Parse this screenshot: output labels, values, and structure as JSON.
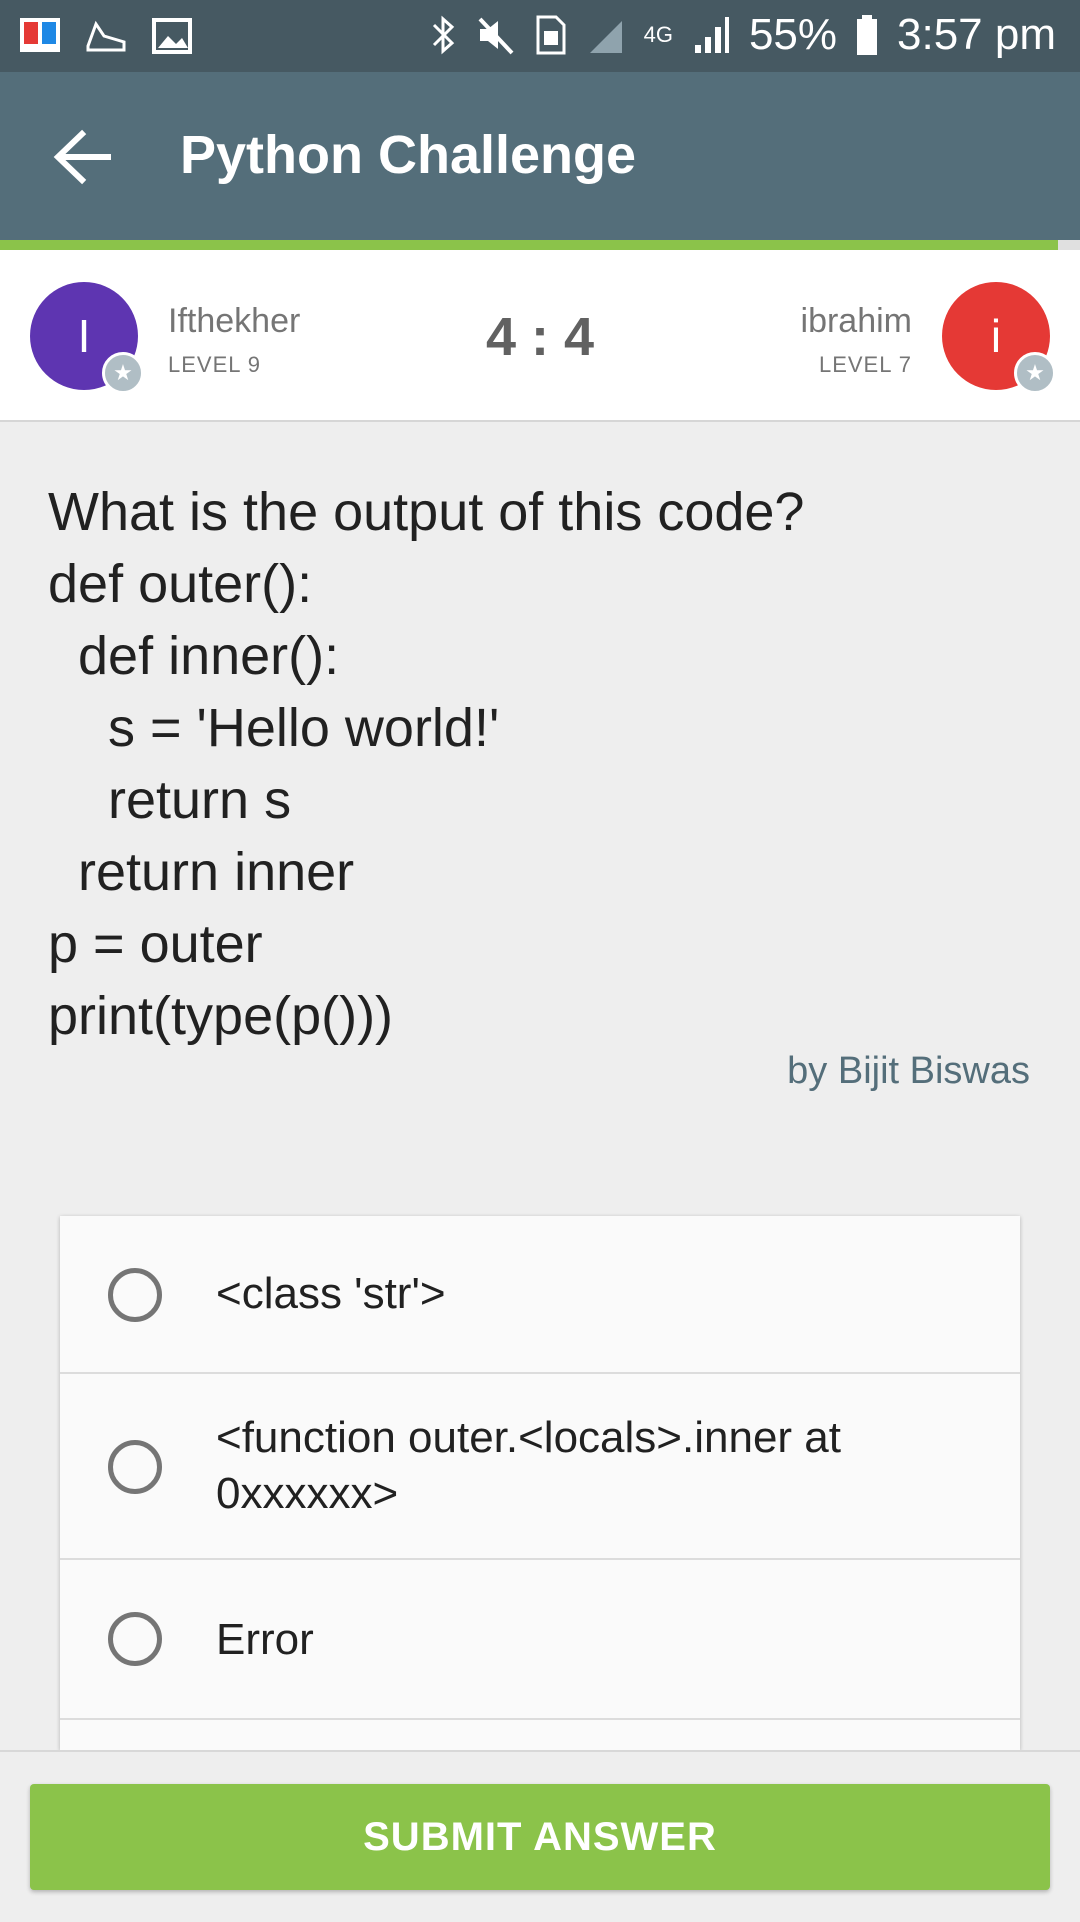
{
  "status_bar": {
    "battery": "55%",
    "time": "3:57 pm",
    "network": "4G",
    "icons": [
      "app-icon",
      "shoe-icon",
      "image-icon",
      "bluetooth-icon",
      "mute-icon",
      "sim-icon",
      "signal-icon",
      "signal-icon",
      "battery-icon"
    ]
  },
  "app_bar": {
    "title": "Python Challenge",
    "back_icon": "arrow-left-icon"
  },
  "progress": {
    "value": 0.98,
    "color": "#8bc34a"
  },
  "players": {
    "left": {
      "initial": "I",
      "name": "Ifthekher",
      "level": "LEVEL 9",
      "color": "#5e35b1"
    },
    "right": {
      "initial": "i",
      "name": "ibrahim",
      "level": "LEVEL 7",
      "color": "#e53935"
    },
    "score": "4 : 4"
  },
  "question": {
    "text": "What is the output of this code?\ndef outer():\n  def inner():\n    s = 'Hello world!'\n    return s\n  return inner\np = outer\nprint(type(p()))",
    "author": "by Bijit Biswas"
  },
  "answers": [
    {
      "text": "<class 'str'>"
    },
    {
      "text": "<function outer.<locals>.inner at 0xxxxxx>"
    },
    {
      "text": "Error"
    },
    {
      "text": ""
    }
  ],
  "submit": {
    "label": "SUBMIT ANSWER"
  }
}
